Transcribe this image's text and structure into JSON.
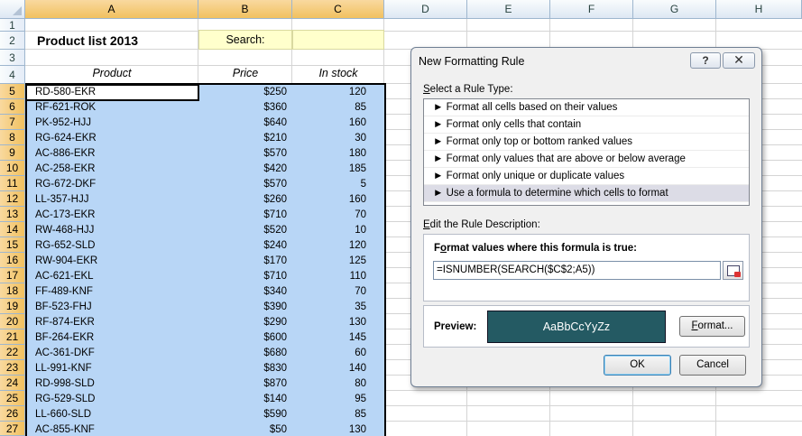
{
  "columns": [
    "A",
    "B",
    "C",
    "D",
    "E",
    "F",
    "G",
    "H"
  ],
  "rows": [
    "1",
    "2",
    "3",
    "4",
    "5",
    "6",
    "7",
    "8",
    "9",
    "10",
    "11",
    "12",
    "13",
    "14",
    "15",
    "16",
    "17",
    "18",
    "19",
    "20",
    "21",
    "22",
    "23",
    "24",
    "25",
    "26",
    "27"
  ],
  "sheet": {
    "title": "Product list 2013",
    "search_label": "Search:",
    "search_value": "",
    "headers": {
      "product": "Product",
      "price": "Price",
      "stock": "In stock"
    },
    "products": [
      {
        "product": "RD-580-EKR",
        "price": "$250",
        "stock": "120"
      },
      {
        "product": "RF-621-ROK",
        "price": "$360",
        "stock": "85"
      },
      {
        "product": "PK-952-HJJ",
        "price": "$640",
        "stock": "160"
      },
      {
        "product": "RG-624-EKR",
        "price": "$210",
        "stock": "30"
      },
      {
        "product": "AC-886-EKR",
        "price": "$570",
        "stock": "180"
      },
      {
        "product": "AC-258-EKR",
        "price": "$420",
        "stock": "185"
      },
      {
        "product": "RG-672-DKF",
        "price": "$570",
        "stock": "5"
      },
      {
        "product": "LL-357-HJJ",
        "price": "$260",
        "stock": "160"
      },
      {
        "product": "AC-173-EKR",
        "price": "$710",
        "stock": "70"
      },
      {
        "product": "RW-468-HJJ",
        "price": "$520",
        "stock": "10"
      },
      {
        "product": "RG-652-SLD",
        "price": "$240",
        "stock": "120"
      },
      {
        "product": "RW-904-EKR",
        "price": "$170",
        "stock": "125"
      },
      {
        "product": "AC-621-EKL",
        "price": "$710",
        "stock": "110"
      },
      {
        "product": "FF-489-KNF",
        "price": "$340",
        "stock": "70"
      },
      {
        "product": "BF-523-FHJ",
        "price": "$390",
        "stock": "35"
      },
      {
        "product": "RF-874-EKR",
        "price": "$290",
        "stock": "130"
      },
      {
        "product": "BF-264-EKR",
        "price": "$600",
        "stock": "145"
      },
      {
        "product": "AC-361-DKF",
        "price": "$680",
        "stock": "60"
      },
      {
        "product": "LL-991-KNF",
        "price": "$830",
        "stock": "140"
      },
      {
        "product": "RD-998-SLD",
        "price": "$870",
        "stock": "80"
      },
      {
        "product": "RG-529-SLD",
        "price": "$140",
        "stock": "95"
      },
      {
        "product": "LL-660-SLD",
        "price": "$590",
        "stock": "85"
      },
      {
        "product": "AC-855-KNF",
        "price": "$50",
        "stock": "130"
      }
    ]
  },
  "dialog": {
    "title": "New Formatting Rule",
    "help_label": "?",
    "close_label": "✕",
    "rule_type_label": "Select a Rule Type:",
    "rule_types": [
      "► Format all cells based on their values",
      "► Format only cells that contain",
      "► Format only top or bottom ranked values",
      "► Format only values that are above or below average",
      "► Format only unique or duplicate values",
      "► Use a formula to determine which cells to format"
    ],
    "selected_rule_index": 5,
    "edit_label": "Edit the Rule Description:",
    "formula_title": "Format values where this formula is true:",
    "formula_value": "=ISNUMBER(SEARCH($C$2;A5))",
    "preview_label": "Preview:",
    "preview_text": "AaBbCcYyZz",
    "preview_bg": "#245a63",
    "format_button": "Format...",
    "ok_button": "OK",
    "cancel_button": "Cancel"
  }
}
